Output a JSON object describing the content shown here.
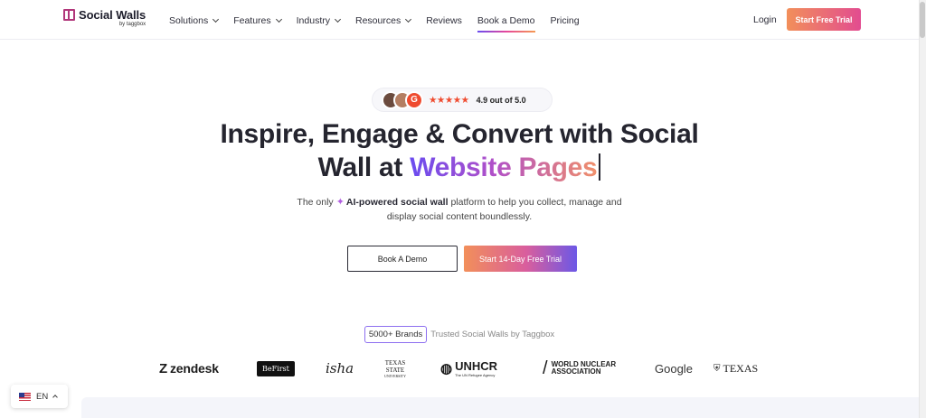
{
  "brand": {
    "name": "Social Walls",
    "by": "by taggbox"
  },
  "nav": {
    "items": [
      {
        "label": "Solutions",
        "dropdown": true
      },
      {
        "label": "Features",
        "dropdown": true
      },
      {
        "label": "Industry",
        "dropdown": true
      },
      {
        "label": "Resources",
        "dropdown": true
      },
      {
        "label": "Reviews",
        "dropdown": false
      },
      {
        "label": "Book a Demo",
        "dropdown": false,
        "active": true
      },
      {
        "label": "Pricing",
        "dropdown": false
      }
    ],
    "login": "Login",
    "cta": "Start Free Trial"
  },
  "rating": {
    "stars": "★★★★★",
    "text": "4.9 out of 5.0",
    "badge": "G"
  },
  "hero": {
    "headline_line1": "Inspire, Engage & Convert with Social",
    "headline_line2_prefix": "Wall at ",
    "headline_highlight": "Website Pages",
    "subtitle_prefix": "The only",
    "subtitle_bold": "AI-powered social wall",
    "subtitle_rest": "platform to help you collect, manage and",
    "subtitle_line2": "display social content boundlessly.",
    "btn_demo": "Book A Demo",
    "btn_trial": "Start 14-Day Free Trial"
  },
  "trusted": {
    "badge": "5000+ Brands",
    "text": "Trusted Social Walls by Taggbox"
  },
  "logos": {
    "zendesk": "zendesk",
    "befirst": "BeFirst",
    "isha": "isha",
    "txstate_1": "TEXAS",
    "txstate_2": "STATE",
    "txstate_3": "UNIVERSITY",
    "unhcr": "UNHCR",
    "unhcr_sub": "The UN Refugee Agency",
    "wna_1": "WORLD NUCLEAR",
    "wna_2": "ASSOCIATION",
    "google": "Google",
    "texas": "TEXAS"
  },
  "language": {
    "code": "EN"
  },
  "colors": {
    "accent_orange": "#f28f5a",
    "accent_pink": "#e24c90",
    "accent_purple": "#6a4cf0",
    "star": "#ef4b2f"
  }
}
